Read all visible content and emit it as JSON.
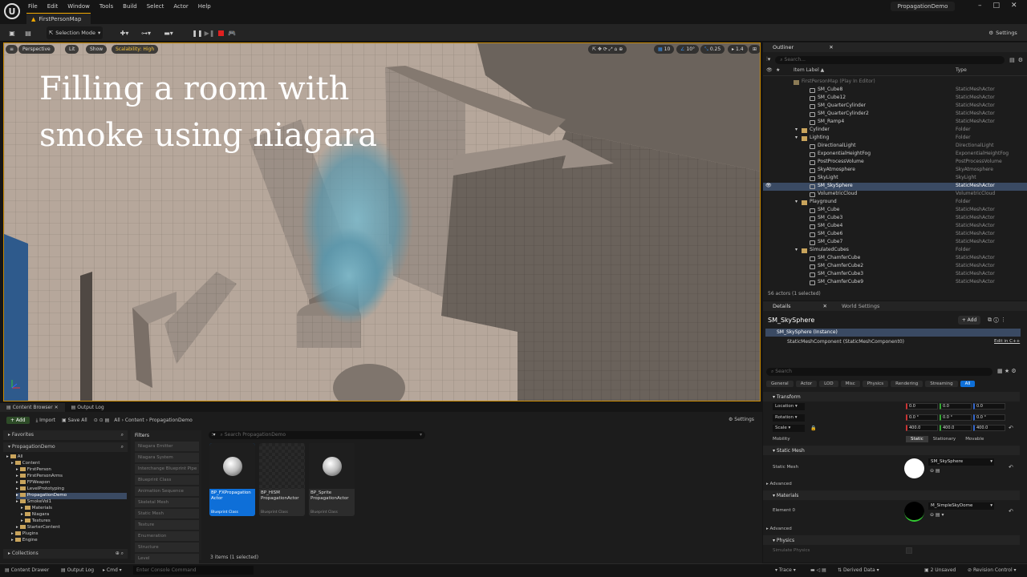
{
  "menu": {
    "logo": "U",
    "items": [
      "File",
      "Edit",
      "Window",
      "Tools",
      "Build",
      "Select",
      "Actor",
      "Help"
    ],
    "map_tab": "FirstPersonMap",
    "project": "PropagationDemo",
    "min": "–",
    "max": "□",
    "close": "✕"
  },
  "toolbar": {
    "selection_mode": "Selection Mode",
    "settings": "Settings"
  },
  "viewport": {
    "perspective": "Perspective",
    "lit": "Lit",
    "show": "Show",
    "scalability": "Scalability: High",
    "grid_value": "10",
    "angle_value": "10°",
    "scale_value": "0.25",
    "camera_speed": "1.4",
    "overlay_title": "Filling a room with smoke using niagara"
  },
  "outliner": {
    "tab": "Outliner",
    "search_placeholder": "Search...",
    "col_label": "Item Label ▲",
    "col_type": "Type",
    "rows": [
      {
        "label": "FirstPersonMap (Play In Editor)",
        "type": "",
        "indent": 0,
        "kind": "map",
        "selected": false
      },
      {
        "label": "SM_Cube8",
        "type": "StaticMeshActor",
        "indent": 2,
        "kind": "actor",
        "selected": false
      },
      {
        "label": "SM_Cube12",
        "type": "StaticMeshActor",
        "indent": 2,
        "kind": "actor",
        "selected": false
      },
      {
        "label": "SM_QuarterCylinder",
        "type": "StaticMeshActor",
        "indent": 2,
        "kind": "actor",
        "selected": false
      },
      {
        "label": "SM_QuarterCylinder2",
        "type": "StaticMeshActor",
        "indent": 2,
        "kind": "actor",
        "selected": false
      },
      {
        "label": "SM_Ramp4",
        "type": "StaticMeshActor",
        "indent": 2,
        "kind": "actor",
        "selected": false
      },
      {
        "label": "Cylinder",
        "type": "Folder",
        "indent": 1,
        "kind": "folder",
        "selected": false
      },
      {
        "label": "Lighting",
        "type": "Folder",
        "indent": 1,
        "kind": "folder",
        "selected": false
      },
      {
        "label": "DirectionalLight",
        "type": "DirectionalLight",
        "indent": 2,
        "kind": "actor",
        "selected": false
      },
      {
        "label": "ExponentialHeightFog",
        "type": "ExponentialHeightFog",
        "indent": 2,
        "kind": "actor",
        "selected": false
      },
      {
        "label": "PostProcessVolume",
        "type": "PostProcessVolume",
        "indent": 2,
        "kind": "actor",
        "selected": false
      },
      {
        "label": "SkyAtmosphere",
        "type": "SkyAtmosphere",
        "indent": 2,
        "kind": "actor",
        "selected": false
      },
      {
        "label": "SkyLight",
        "type": "SkyLight",
        "indent": 2,
        "kind": "actor",
        "selected": false
      },
      {
        "label": "SM_SkySphere",
        "type": "StaticMeshActor",
        "indent": 2,
        "kind": "actor",
        "selected": true
      },
      {
        "label": "VolumetricCloud",
        "type": "VolumetricCloud",
        "indent": 2,
        "kind": "actor",
        "selected": false
      },
      {
        "label": "Playground",
        "type": "Folder",
        "indent": 1,
        "kind": "folder",
        "selected": false
      },
      {
        "label": "SM_Cube",
        "type": "StaticMeshActor",
        "indent": 2,
        "kind": "actor",
        "selected": false
      },
      {
        "label": "SM_Cube3",
        "type": "StaticMeshActor",
        "indent": 2,
        "kind": "actor",
        "selected": false
      },
      {
        "label": "SM_Cube4",
        "type": "StaticMeshActor",
        "indent": 2,
        "kind": "actor",
        "selected": false
      },
      {
        "label": "SM_Cube6",
        "type": "StaticMeshActor",
        "indent": 2,
        "kind": "actor",
        "selected": false
      },
      {
        "label": "SM_Cube7",
        "type": "StaticMeshActor",
        "indent": 2,
        "kind": "actor",
        "selected": false
      },
      {
        "label": "SimulatedCubes",
        "type": "Folder",
        "indent": 1,
        "kind": "folder",
        "selected": false
      },
      {
        "label": "SM_ChamferCube",
        "type": "StaticMeshActor",
        "indent": 2,
        "kind": "actor",
        "selected": false
      },
      {
        "label": "SM_ChamferCube2",
        "type": "StaticMeshActor",
        "indent": 2,
        "kind": "actor",
        "selected": false
      },
      {
        "label": "SM_ChamferCube3",
        "type": "StaticMeshActor",
        "indent": 2,
        "kind": "actor",
        "selected": false
      },
      {
        "label": "SM_ChamferCube9",
        "type": "StaticMeshActor",
        "indent": 2,
        "kind": "actor",
        "selected": false
      }
    ],
    "status": "56 actors (1 selected)"
  },
  "details": {
    "tab": "Details",
    "world_tab": "World Settings",
    "actor_name": "SM_SkySphere",
    "add": "+ Add",
    "instance": "SM_SkySphere (Instance)",
    "component": "StaticMeshComponent (StaticMeshComponent0)",
    "edit_cpp": "Edit in C++",
    "search_placeholder": "Search",
    "filters": [
      "General",
      "Actor",
      "LOD",
      "Misc",
      "Physics",
      "Rendering",
      "Streaming",
      "All"
    ],
    "transform": "Transform",
    "location": "Location",
    "rotation": "Rotation",
    "scale": "Scale",
    "loc_vals": [
      "0.0",
      "0.0",
      "0.0"
    ],
    "rot_vals": [
      "0.0 °",
      "0.0 °",
      "0.0 °"
    ],
    "scale_vals": [
      "400.0",
      "400.0",
      "400.0"
    ],
    "mobility": "Mobility",
    "mob_opts": [
      "Static",
      "Stationary",
      "Movable"
    ],
    "static_mesh_hdr": "Static Mesh",
    "static_mesh_lbl": "Static Mesh",
    "static_mesh_val": "SM_SkySphere",
    "advanced": "Advanced",
    "materials_hdr": "Materials",
    "element0": "Element 0",
    "material_val": "M_SimpleSkyDome",
    "advanced2": "Advanced",
    "physics_hdr": "Physics",
    "simulate": "Simulate Physics"
  },
  "content_browser": {
    "tab": "Content Browser",
    "log_tab": "Output Log",
    "add": "+ Add",
    "import": "Import",
    "save_all": "Save All",
    "path": [
      "All",
      "Content",
      "PropagationDemo"
    ],
    "settings": "Settings",
    "favorites": "Favorites",
    "project": "PropagationDemo",
    "collections": "Collections",
    "tree": [
      {
        "label": "All",
        "indent": 0
      },
      {
        "label": "Content",
        "indent": 1
      },
      {
        "label": "FirstPerson",
        "indent": 2
      },
      {
        "label": "FirstPersonArms",
        "indent": 2
      },
      {
        "label": "FPWeapon",
        "indent": 2
      },
      {
        "label": "LevelPrototyping",
        "indent": 2
      },
      {
        "label": "PropagationDemo",
        "indent": 2,
        "selected": true
      },
      {
        "label": "SmokeVol1",
        "indent": 2
      },
      {
        "label": "Materials",
        "indent": 3
      },
      {
        "label": "Niagara",
        "indent": 3
      },
      {
        "label": "Textures",
        "indent": 3
      },
      {
        "label": "StarterContent",
        "indent": 2
      },
      {
        "label": "Plugins",
        "indent": 1
      },
      {
        "label": "Engine",
        "indent": 1
      }
    ],
    "filters_title": "Filters",
    "filter_items": [
      "Niagara Emitter",
      "Niagara System",
      "Interchange Blueprint Pipe",
      "Blueprint Class",
      "Animation Sequence",
      "Skeletal Mesh",
      "Static Mesh",
      "Texture",
      "Enumeration",
      "Structure",
      "Level"
    ],
    "search_placeholder": "Search PropagationDemo",
    "assets": [
      {
        "name": "BP_FXPropagation Actor",
        "cls": "Blueprint Class",
        "selected": true,
        "thumb": "ball"
      },
      {
        "name": "BP_HISM PropagationActor",
        "cls": "Blueprint Class",
        "selected": false,
        "thumb": "checker"
      },
      {
        "name": "BP_Sprite PropagationActor",
        "cls": "Blueprint Class",
        "selected": false,
        "thumb": "ball"
      }
    ],
    "count": "3 items (1 selected)"
  },
  "statusbar": {
    "content_drawer": "Content Drawer",
    "output_log": "Output Log",
    "cmd": "Cmd",
    "console_placeholder": "Enter Console Command",
    "trace": "Trace",
    "derived": "Derived Data",
    "unsaved": "2 Unsaved",
    "revision": "Revision Control"
  },
  "colors": {
    "accent": "#f2a900",
    "selection": "#0e6fd8",
    "row_selected": "#3a4a63",
    "recording": "#e02020"
  }
}
